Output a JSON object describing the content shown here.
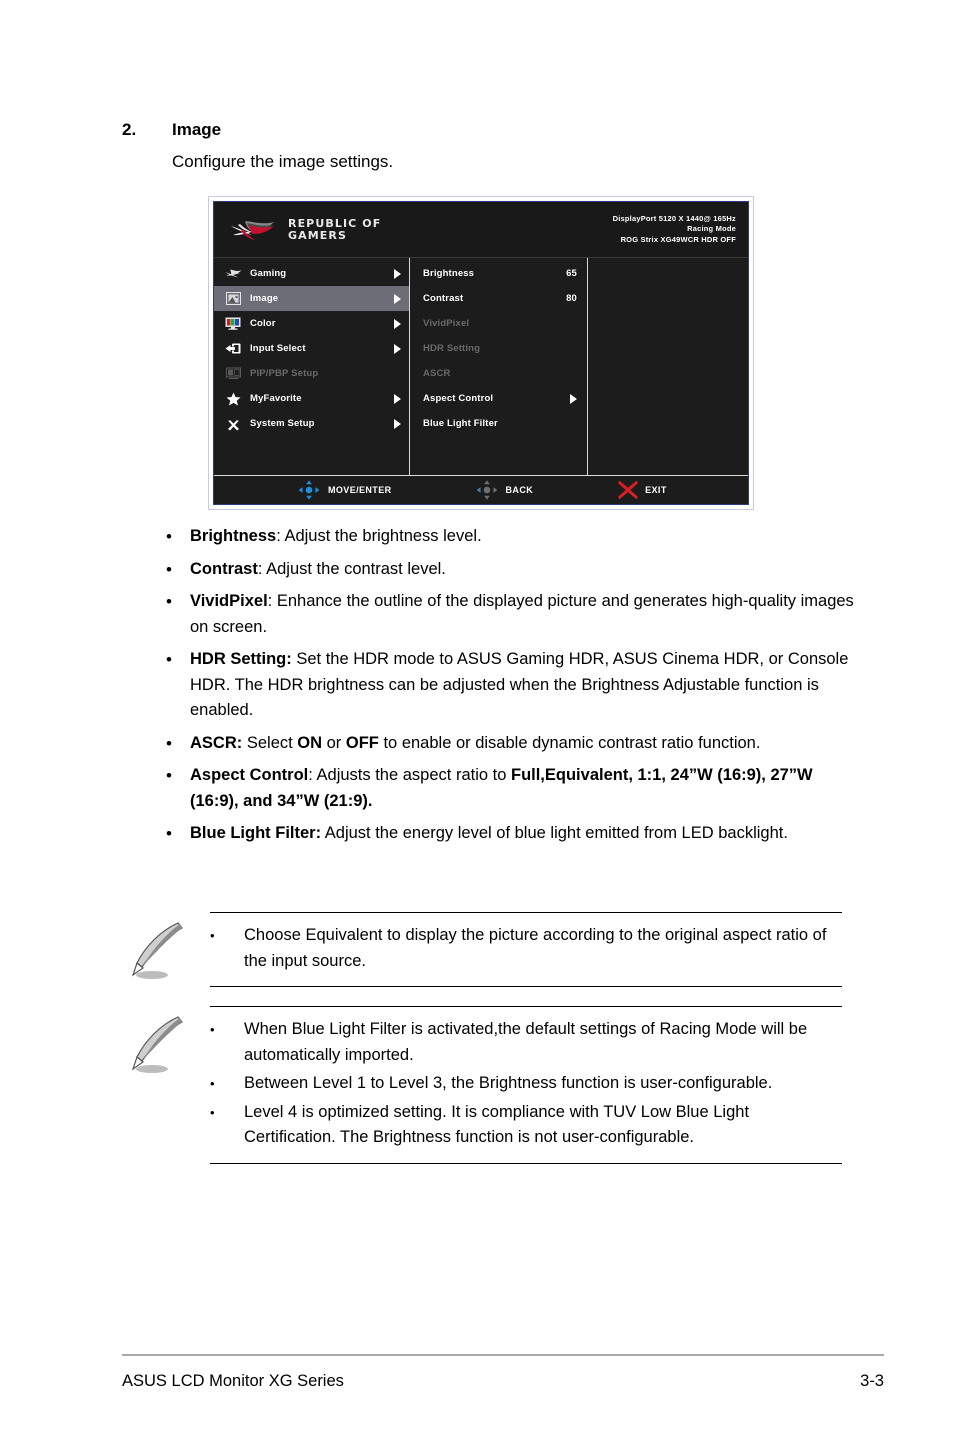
{
  "page": {
    "section_number": "2.",
    "section_title": "Image",
    "section_desc": "Configure the image settings."
  },
  "osd": {
    "brand_line1": "REPUBLIC OF",
    "brand_line2": "GAMERS",
    "logo_name": "rog-logo",
    "info": {
      "line1": "DisplayPort 5120 X 1440@ 165Hz",
      "line2": "Racing Mode",
      "line3": "ROG Strix XG49WCR HDR OFF"
    },
    "main_menu": [
      {
        "label": "Gaming",
        "icon": "rog-eye-icon",
        "arrow": true,
        "disabled": false,
        "selected": false
      },
      {
        "label": "Image",
        "icon": "picture-icon",
        "arrow": true,
        "disabled": false,
        "selected": true
      },
      {
        "label": "Color",
        "icon": "color-monitor-icon",
        "arrow": true,
        "disabled": false,
        "selected": false
      },
      {
        "label": "Input Select",
        "icon": "input-arrow-icon",
        "arrow": true,
        "disabled": false,
        "selected": false
      },
      {
        "label": "PIP/PBP Setup",
        "icon": "pip-pbp-icon",
        "arrow": false,
        "disabled": true,
        "selected": false
      },
      {
        "label": "MyFavorite",
        "icon": "star-icon",
        "arrow": true,
        "disabled": false,
        "selected": false
      },
      {
        "label": "System Setup",
        "icon": "tools-icon",
        "arrow": true,
        "disabled": false,
        "selected": false
      }
    ],
    "sub_menu": [
      {
        "label": "Brightness",
        "value": "65",
        "arrow": false,
        "disabled": false
      },
      {
        "label": "Contrast",
        "value": "80",
        "arrow": false,
        "disabled": false
      },
      {
        "label": "VividPixel",
        "value": "",
        "arrow": false,
        "disabled": true
      },
      {
        "label": "HDR Setting",
        "value": "",
        "arrow": false,
        "disabled": true
      },
      {
        "label": "ASCR",
        "value": "",
        "arrow": false,
        "disabled": true
      },
      {
        "label": "Aspect Control",
        "value": "",
        "arrow": true,
        "disabled": false
      },
      {
        "label": "Blue Light Filter",
        "value": "",
        "arrow": false,
        "disabled": false
      }
    ],
    "footer": {
      "move_label": "MOVE/ENTER",
      "move_icon": "joystick-blue-icon",
      "back_label": "BACK",
      "back_icon": "joystick-gray-icon",
      "exit_label": "EXIT",
      "exit_icon": "close-x-icon"
    },
    "colors": {
      "background": "#1c1c1c",
      "border": "#2d3a86",
      "selected_row": "#6d6d78",
      "disabled_text": "#6a6a6a",
      "exit_x": "#d81f26",
      "joystick_active": "#1f8fe0",
      "rog_red": "#c8102e"
    }
  },
  "bullets": [
    {
      "bold": "Brightness",
      "sep": ": ",
      "rest": "Adjust the brightness level."
    },
    {
      "bold": "Contrast",
      "sep": ": ",
      "rest": "Adjust the contrast level."
    },
    {
      "bold": "VividPixel",
      "sep": ": ",
      "rest": "Enhance the outline of the displayed picture and generates high-quality images on screen."
    },
    {
      "bold": "HDR Setting:",
      "sep": " ",
      "rest": "Set the HDR mode to ASUS Gaming HDR, ASUS Cinema HDR, or Console HDR. The HDR brightness can be adjusted when the Brightness Adjustable function is enabled."
    },
    {
      "bold": "ASCR:",
      "sep": " ",
      "rest": "Select ON or OFF to enable or disable dynamic contrast ratio function.",
      "inline_bold": [
        "ON",
        "OFF"
      ]
    },
    {
      "bold": "Aspect Control",
      "sep": ": ",
      "rest": "Adjusts the aspect ratio to Full,Equivalent, 1:1, 24”W (16:9), 27”W (16:9), and 34”W (21:9).",
      "tail_bold": "Full,Equivalent, 1:1, 24”W (16:9), 27”W (16:9), and 34”W (21:9)."
    },
    {
      "bold": "Blue Light Filter:",
      "sep": " ",
      "rest": "Adjust the energy level of blue light emitted from LED backlight."
    }
  ],
  "notes": [
    {
      "icon": "quill-note-icon",
      "items": [
        "Choose  Equivalent to display the picture according to the original aspect ratio of the input source."
      ]
    },
    {
      "icon": "quill-note-icon",
      "items": [
        "When Blue Light Filter is activated,the default settings of Racing Mode will be automatically imported.",
        "Between Level 1 to Level 3, the Brightness function is user-configurable.",
        "Level 4 is optimized setting. It is compliance with TUV Low Blue Light Certification. The Brightness function is not user-configurable."
      ]
    }
  ],
  "page_footer": {
    "left": "ASUS LCD Monitor XG Series",
    "right": "3-3"
  },
  "bullet_glyph": "•"
}
